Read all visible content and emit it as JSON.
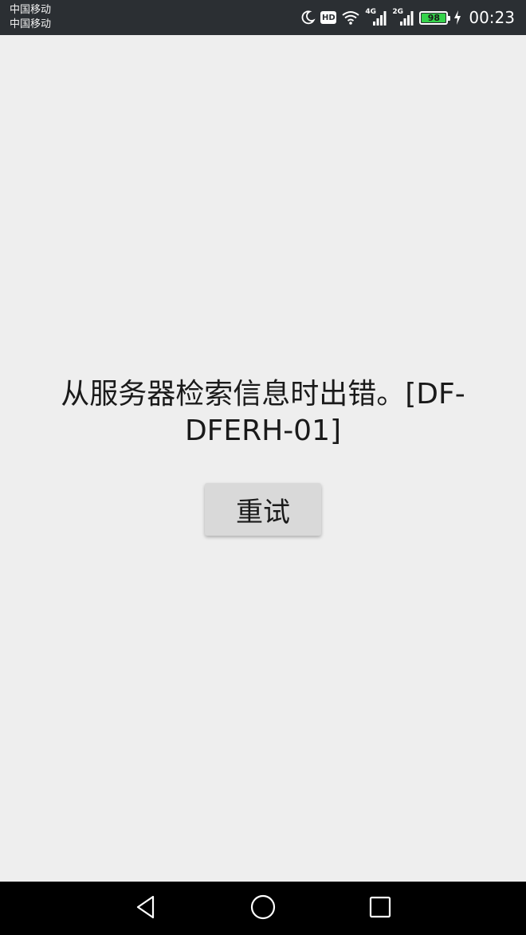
{
  "status_bar": {
    "carrier_1": "中国移动",
    "carrier_2": "中国移动",
    "hd_label": "HD",
    "network_1": "4G",
    "network_2": "2G",
    "battery_level": "98",
    "time": "00:23",
    "icons": [
      "moon-icon",
      "hd-icon",
      "wifi-icon",
      "signal-4g-icon",
      "signal-2g-icon",
      "battery-icon",
      "charging-icon"
    ],
    "colors": {
      "background": "#2b2f33",
      "battery_fill": "#35d24b"
    }
  },
  "main": {
    "error_message": "从服务器检索信息时出错。[DF-DFERH-01]",
    "retry_label": "重试"
  },
  "nav_bar": {
    "icons": [
      "back-icon",
      "home-icon",
      "recents-icon"
    ]
  }
}
